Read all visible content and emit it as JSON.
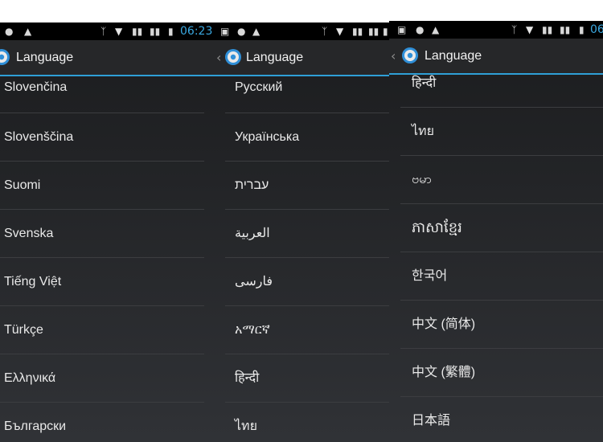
{
  "colors": {
    "accent": "#2f9fd6",
    "statusbar": "#000000",
    "background": "#262729"
  },
  "panels": [
    {
      "status": {
        "time": "06:23",
        "icons": [
          "alert-icon",
          "warning-icon",
          "bluetooth-icon",
          "wifi-icon",
          "signal-icon",
          "signal-icon",
          "battery-icon"
        ]
      },
      "actionbar": {
        "title": "Language",
        "icon": "settings-gear-icon"
      },
      "items": [
        "Slovenčina",
        "Slovenščina",
        "Suomi",
        "Svenska",
        "Tiếng Việt",
        "Türkçe",
        "Ελληνικά",
        "Български"
      ]
    },
    {
      "status": {
        "time": "",
        "icons": [
          "image-icon",
          "alert-icon",
          "warning-icon",
          "bluetooth-icon",
          "wifi-icon",
          "signal-icon",
          "signal-icon",
          "battery-icon"
        ]
      },
      "actionbar": {
        "title": "Language",
        "icon": "settings-gear-icon"
      },
      "items": [
        "Русский",
        "Українська",
        "עברית",
        "العربية",
        "فارسی",
        "አማርኛ",
        "हिन्दी",
        "ไทย"
      ]
    },
    {
      "status": {
        "time": "06",
        "icons": [
          "image-icon",
          "alert-icon",
          "warning-icon",
          "bluetooth-icon",
          "wifi-icon",
          "signal-icon",
          "signal-icon",
          "battery-icon"
        ]
      },
      "actionbar": {
        "title": "Language",
        "icon": "settings-gear-icon"
      },
      "items": [
        "हिन्दी",
        "ไทย",
        "ဗမာ",
        "ភាសាខ្មែរ",
        "한국어",
        "中文 (简体)",
        "中文 (繁體)",
        "日本語"
      ]
    }
  ]
}
